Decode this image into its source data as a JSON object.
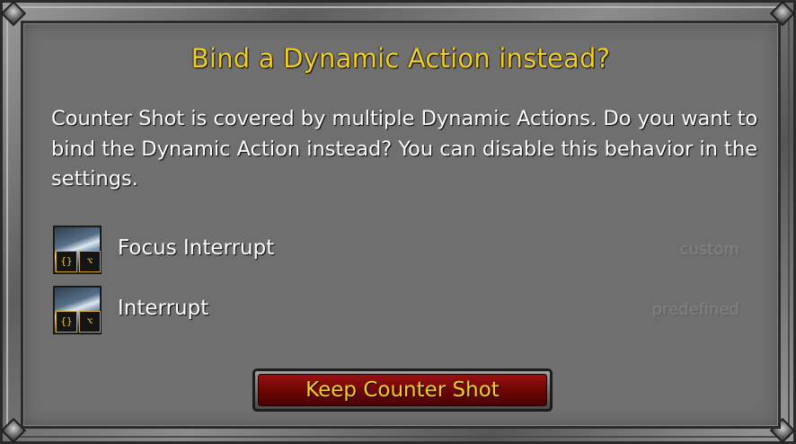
{
  "dialog": {
    "title": "Bind a Dynamic Action instead?",
    "message": "Counter Shot is covered by multiple Dynamic Actions. Do you want to bind the Dynamic Action instead? You can disable this behavior in the settings.",
    "title_color": "#f2cf1f",
    "background_color": "#6f6f6f"
  },
  "actions": [
    {
      "name": "Focus Interrupt",
      "type": "custom",
      "icon": "counter-shot-icon",
      "badges": [
        "code-icon",
        "nodes-icon"
      ]
    },
    {
      "name": "Interrupt",
      "type": "predefined",
      "icon": "counter-shot-icon",
      "badges": [
        "code-icon",
        "nodes-icon"
      ]
    }
  ],
  "buttons": {
    "keep_label": "Keep Counter Shot",
    "keep_color": "#7a0808"
  }
}
